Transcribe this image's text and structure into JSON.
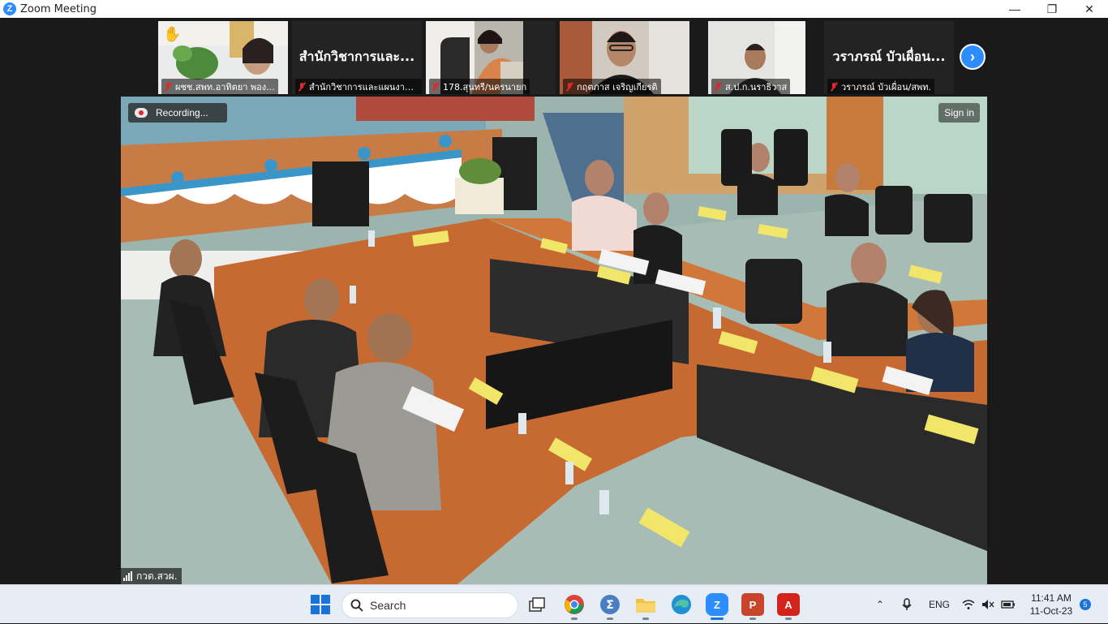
{
  "window": {
    "title": "Zoom Meeting",
    "controls": {
      "minimize": "—",
      "maximize": "❐",
      "close": "✕"
    }
  },
  "gallery": {
    "participants": [
      {
        "display_name": "ผชช.สพท.อาทิตยา พอง...",
        "video": true,
        "muted": true,
        "hand_raised": true
      },
      {
        "display_name": "สำนักวิชาการและแผนงาน...",
        "big_name": "สำนักวิชาการและ...",
        "video": false,
        "muted": true
      },
      {
        "display_name": "178.สุนทรี/นครนายก",
        "video": true,
        "muted": true
      },
      {
        "display_name": "กฤตภาส เจริญเกียรติ",
        "video": true,
        "muted": true
      },
      {
        "display_name": "ส.ป.ก.นราธิวาส",
        "video": true,
        "muted": true
      },
      {
        "display_name": "วราภรณ์ บัวเผื่อน/สพท.",
        "big_name": "วราภรณ์ บัวเผื่อน...",
        "video": false,
        "muted": true
      }
    ],
    "next_page_icon": "chevron-right-icon"
  },
  "stage": {
    "recording_label": "Recording...",
    "sign_in_label": "Sign in",
    "speaker_name": "กวด.สวผ."
  },
  "taskbar": {
    "search_placeholder": "Search",
    "apps": [
      "task-view",
      "chrome",
      "sigma",
      "file-explorer",
      "edge",
      "zoom",
      "powerpoint",
      "acrobat"
    ],
    "tray": {
      "language": "ENG",
      "time": "11:41 AM",
      "date": "11-Oct-23",
      "notification_count": "5"
    }
  },
  "colors": {
    "zoom_blue": "#2d8cff",
    "mute_red": "#e02828",
    "taskbar_bg": "#e7edf5"
  }
}
